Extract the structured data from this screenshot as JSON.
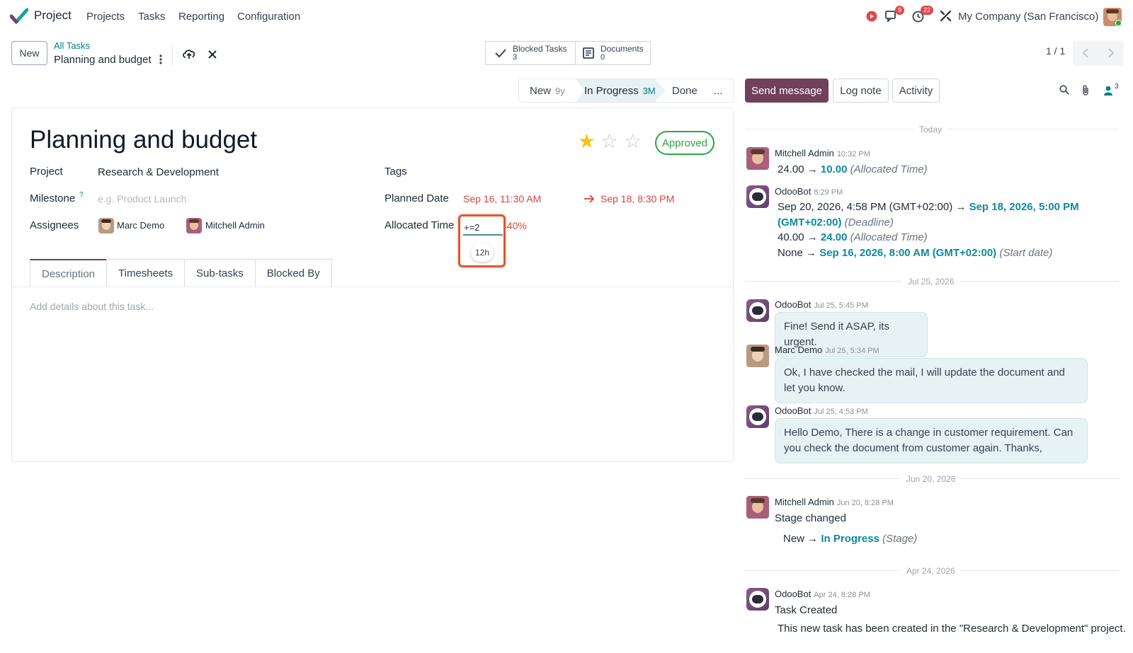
{
  "navbar": {
    "app_name": "Project",
    "menu": [
      "Projects",
      "Tasks",
      "Reporting",
      "Configuration"
    ],
    "messages_badge": "9",
    "activities_badge": "22",
    "company": "My Company (San Francisco)"
  },
  "control": {
    "new_label": "New",
    "breadcrumb_parent": "All Tasks",
    "breadcrumb_current": "Planning and budget",
    "smart_buttons": [
      {
        "label": "Blocked Tasks",
        "count": "3"
      },
      {
        "label": "Documents",
        "count": "0"
      }
    ],
    "pager": "1 / 1"
  },
  "statusbar": {
    "stages": [
      {
        "label": "New",
        "age": "9y"
      },
      {
        "label": "In Progress",
        "age": "3M"
      },
      {
        "label": "Done",
        "age": ""
      },
      {
        "label": "...",
        "age": ""
      }
    ]
  },
  "form": {
    "title": "Planning and budget",
    "priority_stars": 1,
    "state_label": "Approved",
    "project_label": "Project",
    "project_value": "Research & Development",
    "milestone_label": "Milestone",
    "milestone_help": "?",
    "milestone_placeholder": "e.g. Product Launch",
    "assignees_label": "Assignees",
    "assignees": [
      "Marc Demo",
      "Mitchell Admin"
    ],
    "tags_label": "Tags",
    "planned_date_label": "Planned Date",
    "planned_start": "Sep 16, 11:30 AM",
    "planned_end": "Sep 18, 8:30 PM",
    "allocated_label": "Allocated Time",
    "allocated_input": "+=2",
    "allocated_suggestion": "12h",
    "allocated_percent": "440%",
    "tabs": [
      "Description",
      "Timesheets",
      "Sub-tasks",
      "Blocked By"
    ],
    "description_placeholder": "Add details about this task..."
  },
  "chatter": {
    "send_message": "Send message",
    "log_note": "Log note",
    "activity": "Activity",
    "followers_count": "3",
    "separators": [
      "Today",
      "Jul 25, 2026",
      "Jun 20, 2026",
      "Apr 24, 2026"
    ],
    "messages": [
      {
        "author": "Mitchell Admin",
        "date": "10:32 PM",
        "lines": [
          {
            "old": "24.00",
            "new": "10.00",
            "field": "(Allocated Time)"
          }
        ]
      },
      {
        "author": "OdooBot",
        "date": "8:29 PM",
        "lines": [
          {
            "old": "Sep 20, 2026, 4:58 PM (GMT+02:00)",
            "new": "Sep 18, 2026, 5:00 PM",
            "new2": "(GMT+02:00)",
            "field": "(Deadline)"
          },
          {
            "old": "40.00",
            "new": "24.00",
            "field": "(Allocated Time)"
          },
          {
            "old": "None",
            "new": "Sep 16, 2026, 8:00 AM (GMT+02:00)",
            "field": "(Start date)"
          }
        ]
      },
      {
        "author": "OdooBot",
        "date": "Jul 25, 5:45 PM",
        "body": "Fine! Send it ASAP, its urgent."
      },
      {
        "author": "Marc Demo",
        "date": "Jul 25, 5:34 PM",
        "body": "Ok, I have checked the mail, I will update the document and let you know."
      },
      {
        "author": "OdooBot",
        "date": "Jul 25, 4:53 PM",
        "body": "Hello Demo, There is a change in customer requirement. Can you check the document from customer again. Thanks,"
      },
      {
        "author": "Mitchell Admin",
        "date": "Jun 20, 8:28 PM",
        "title": "Stage changed",
        "lines": [
          {
            "old": "New",
            "new": "In Progress",
            "field": "(Stage)"
          }
        ]
      },
      {
        "author": "OdooBot",
        "date": "Apr 24, 8:28 PM",
        "title": "Task Created",
        "body": "This new task has been created in the \"Research & Development\" project."
      }
    ]
  },
  "colors": {
    "brand": "#71405b",
    "accent": "#017e84",
    "danger": "#d6453d",
    "success": "#28a745",
    "highlight": "#e0562e"
  }
}
